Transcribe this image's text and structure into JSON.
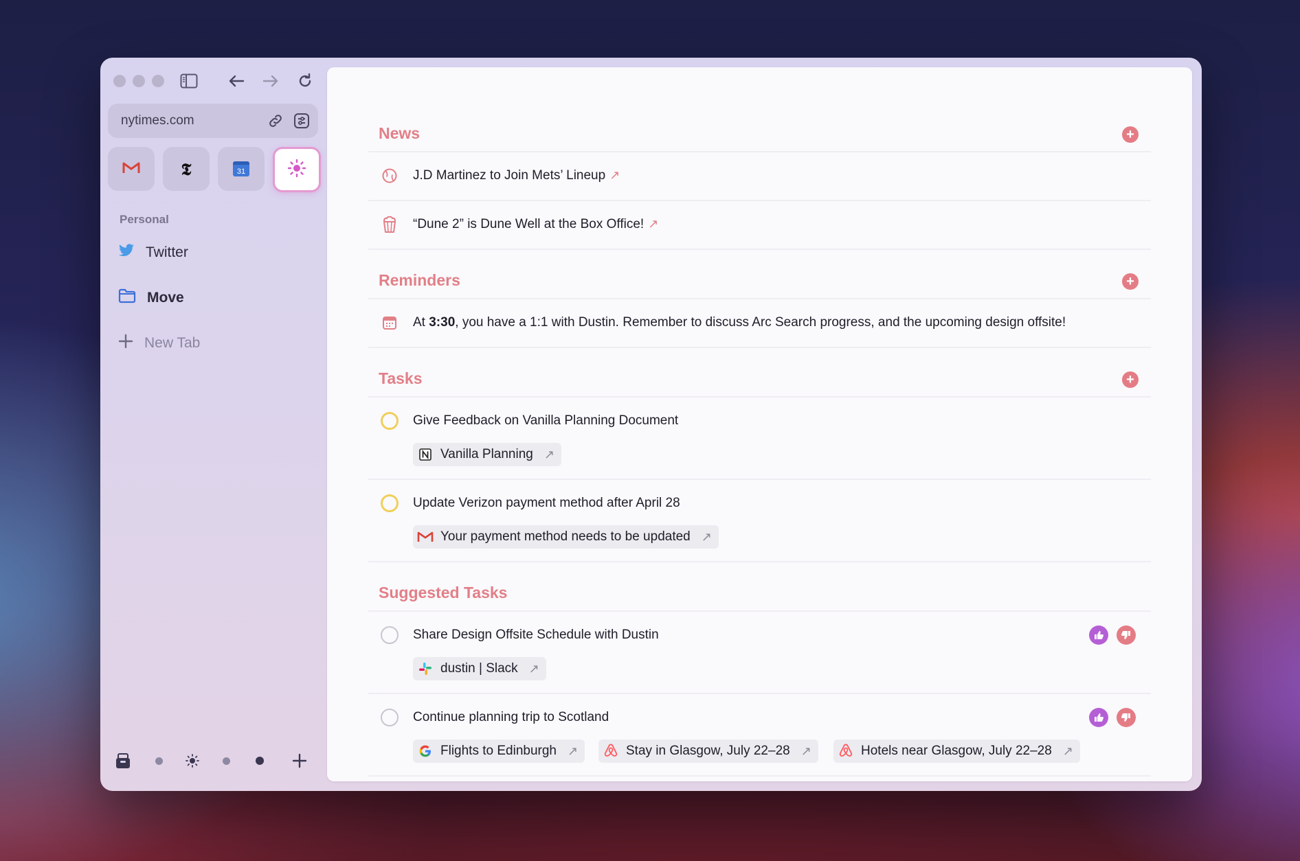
{
  "browser": {
    "url": "nytimes.com",
    "sidebar_section": "Personal",
    "sidebar_items": [
      {
        "label": "Twitter",
        "icon": "twitter-icon"
      },
      {
        "label": "Move",
        "icon": "folder-icon"
      },
      {
        "label": "New Tab",
        "icon": "plus-icon"
      }
    ],
    "pinned_tabs": [
      {
        "name": "Gmail",
        "icon": "gmail-icon"
      },
      {
        "name": "New York Times",
        "icon": "nyt-icon"
      },
      {
        "name": "Google Calendar",
        "icon": "calendar-icon",
        "calendar_day": "31"
      },
      {
        "name": "Current tab",
        "icon": "sun-icon",
        "active": true
      }
    ]
  },
  "sections": {
    "news": {
      "title": "News",
      "items": [
        {
          "text": "J.D Martinez to Join Mets’ Lineup",
          "icon": "baseball-icon"
        },
        {
          "text": "“Dune 2” is Dune Well at the Box Office!",
          "icon": "popcorn-icon"
        }
      ]
    },
    "reminders": {
      "title": "Reminders",
      "item": {
        "prefix": "At ",
        "time": "3:30",
        "text": ", you have a 1:1 with Dustin. Remember to discuss Arc Search progress, and the upcoming design offsite!",
        "icon": "calendar-icon"
      }
    },
    "tasks": {
      "title": "Tasks",
      "items": [
        {
          "text": "Give Feedback on Vanilla Planning Document",
          "chip": "Vanilla Planning",
          "chip_icon": "notion-icon"
        },
        {
          "text": "Update Verizon payment method after April 28",
          "chip": "Your payment method needs to be updated",
          "chip_icon": "gmail-icon"
        }
      ]
    },
    "suggested": {
      "title": "Suggested Tasks",
      "items": [
        {
          "text": "Share Design Offsite Schedule with Dustin",
          "chips": [
            {
              "label": "dustin | Slack",
              "icon": "slack-icon"
            }
          ]
        },
        {
          "text": "Continue planning trip to Scotland",
          "chips": [
            {
              "label": "Flights to Edinburgh",
              "icon": "google-icon"
            },
            {
              "label": "Stay in Glasgow, July 22–28",
              "icon": "airbnb-icon"
            },
            {
              "label": "Hotels near Glasgow, July 22–28",
              "icon": "airbnb-icon"
            }
          ]
        }
      ]
    }
  },
  "colors": {
    "accent": "#e27f87",
    "task_circle": "#f0cf5a",
    "thumbs_up": "#b55fd6",
    "thumbs_down": "#e47c85"
  }
}
